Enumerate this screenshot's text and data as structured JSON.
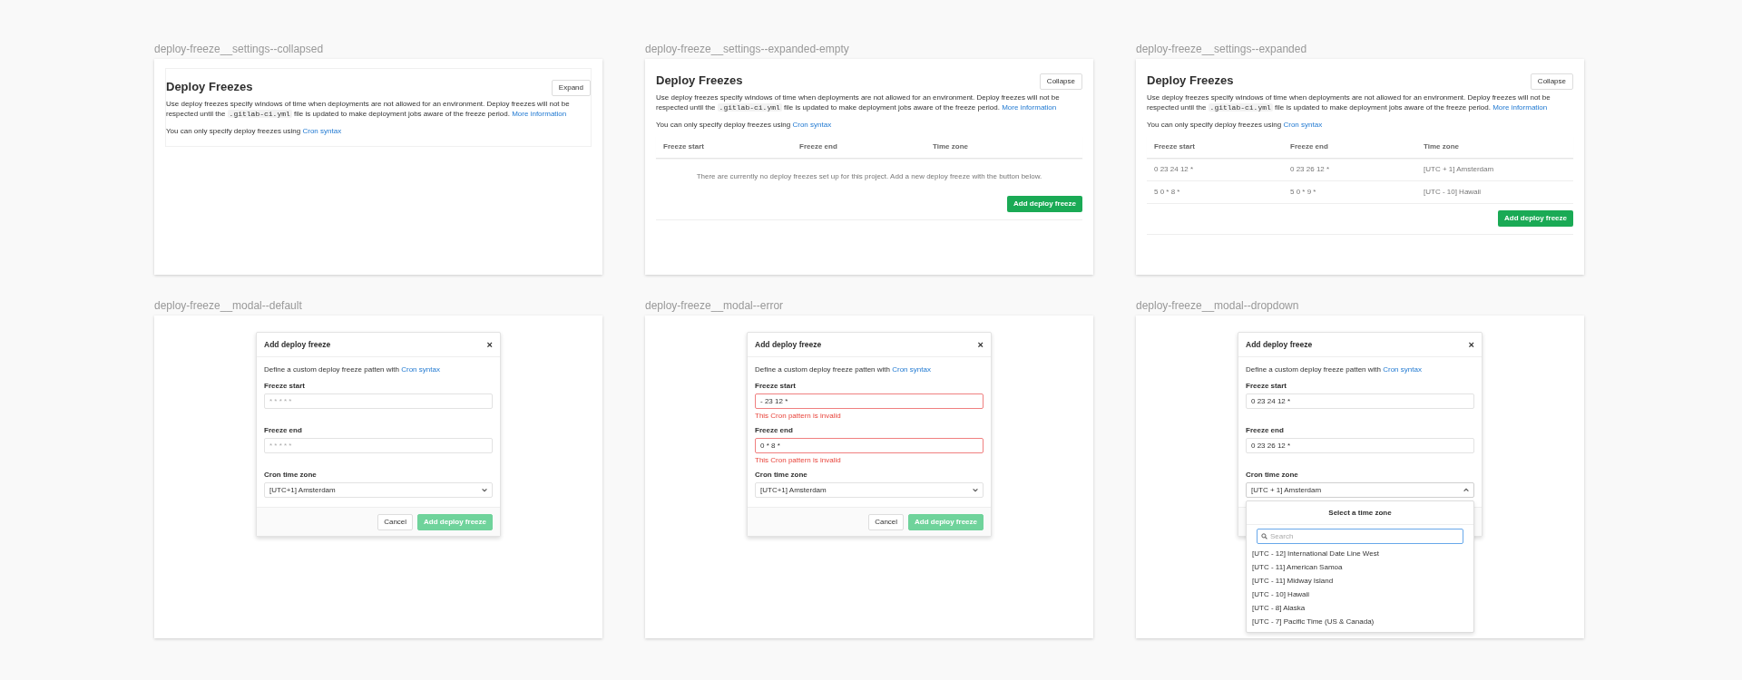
{
  "boards": [
    {
      "label": "deploy-freeze__settings--collapsed",
      "kind": "settings",
      "expanded": false,
      "title": "Deploy Freezes",
      "toggle": "Expand",
      "description": {
        "before": "Use deploy freezes specify windows of time when deployments are not allowed for an environment. Deploy freezes will not be respected until the",
        "code": ".gitlab-ci.yml",
        "after": "file is updated to make deployment jobs aware of the freeze period.",
        "link": "More information"
      },
      "note": {
        "text": "You can only specify deploy freezes using",
        "link": "Cron syntax"
      }
    },
    {
      "label": "deploy-freeze__settings--expanded-empty",
      "kind": "settings",
      "expanded": true,
      "title": "Deploy Freezes",
      "toggle": "Collapse",
      "description": {
        "before": "Use deploy freezes specify windows of time when deployments are not allowed for an environment. Deploy freezes will not be respected until the",
        "code": ".gitlab-ci.yml",
        "after": "file is updated to make deployment jobs aware of the freeze period.",
        "link": "More information"
      },
      "note": {
        "text": "You can only specify deploy freezes using",
        "link": "Cron syntax"
      },
      "table": {
        "columns": [
          "Freeze start",
          "Freeze end",
          "Time zone"
        ],
        "empty_message": "There are currently no deploy freezes set up for this project. Add a new deploy freeze with the button below."
      },
      "add_button": "Add deploy freeze"
    },
    {
      "label": "deploy-freeze__settings--expanded",
      "kind": "settings",
      "expanded": true,
      "title": "Deploy Freezes",
      "toggle": "Collapse",
      "description": {
        "before": "Use deploy freezes specify windows of time when deployments are not allowed for an environment. Deploy freezes will not be respected until the",
        "code": ".gitlab-ci.yml",
        "after": "file is updated to make deployment jobs aware of the freeze period.",
        "link": "More information"
      },
      "note": {
        "text": "You can only specify deploy freezes using",
        "link": "Cron syntax"
      },
      "table": {
        "columns": [
          "Freeze start",
          "Freeze end",
          "Time zone"
        ],
        "rows": [
          [
            "0 23 24 12 *",
            "0 23 26 12 *",
            "[UTC + 1] Amsterdam"
          ],
          [
            "5 0 * 8 *",
            "5 0 * 9 *",
            "[UTC - 10] Hawaii"
          ]
        ]
      },
      "add_button": "Add deploy freeze"
    },
    {
      "label": "deploy-freeze__modal--default",
      "kind": "modal",
      "title": "Add deploy freeze",
      "close": "×",
      "intro": {
        "text": "Define a custom deploy freeze patten with",
        "link": "Cron syntax"
      },
      "fields": [
        {
          "label": "Freeze start",
          "placeholder": "* * * * *",
          "invalid": false
        },
        {
          "label": "Freeze end",
          "placeholder": "* * * * *",
          "invalid": false
        }
      ],
      "timezone": {
        "label": "Cron time zone",
        "value": "[UTC+1] Amsterdam",
        "open": false
      },
      "buttons": [
        {
          "label": "Cancel",
          "kind": "secondary"
        },
        {
          "label": "Add deploy freeze",
          "kind": "primary",
          "disabled": true
        }
      ]
    },
    {
      "label": "deploy-freeze__modal--error",
      "kind": "modal",
      "title": "Add deploy freeze",
      "close": "×",
      "intro": {
        "text": "Define a custom deploy freeze patten with",
        "link": "Cron syntax"
      },
      "fields": [
        {
          "label": "Freeze start",
          "value": "- 23 12 *",
          "invalid": true,
          "error": "This Cron pattern is invalid"
        },
        {
          "label": "Freeze end",
          "value": "0 * 8 *",
          "invalid": true,
          "error": "This Cron pattern is invalid"
        }
      ],
      "timezone": {
        "label": "Cron time zone",
        "value": "[UTC+1] Amsterdam",
        "open": false
      },
      "buttons": [
        {
          "label": "Cancel",
          "kind": "secondary"
        },
        {
          "label": "Add deploy freeze",
          "kind": "primary",
          "disabled": true
        }
      ]
    },
    {
      "label": "deploy-freeze__modal--dropdown",
      "kind": "modal",
      "title": "Add deploy freeze",
      "close": "×",
      "intro": {
        "text": "Define a custom deploy freeze patten with",
        "link": "Cron syntax"
      },
      "fields": [
        {
          "label": "Freeze start",
          "value": "0 23 24 12 *",
          "invalid": false
        },
        {
          "label": "Freeze end",
          "value": "0 23 26 12 *",
          "invalid": false
        }
      ],
      "timezone": {
        "label": "Cron time zone",
        "value": "[UTC + 1] Amsterdam",
        "open": true
      },
      "dropdown": {
        "title": "Select a time zone",
        "search_placeholder": "Search",
        "options": [
          "[UTC - 12] International Date Line West",
          "[UTC - 11] American Samoa",
          "[UTC - 11] Midway Island",
          "[UTC - 10] Hawaii",
          "[UTC - 8] Alaska",
          "[UTC - 7] Pacific Time (US & Canada)"
        ]
      }
    }
  ]
}
